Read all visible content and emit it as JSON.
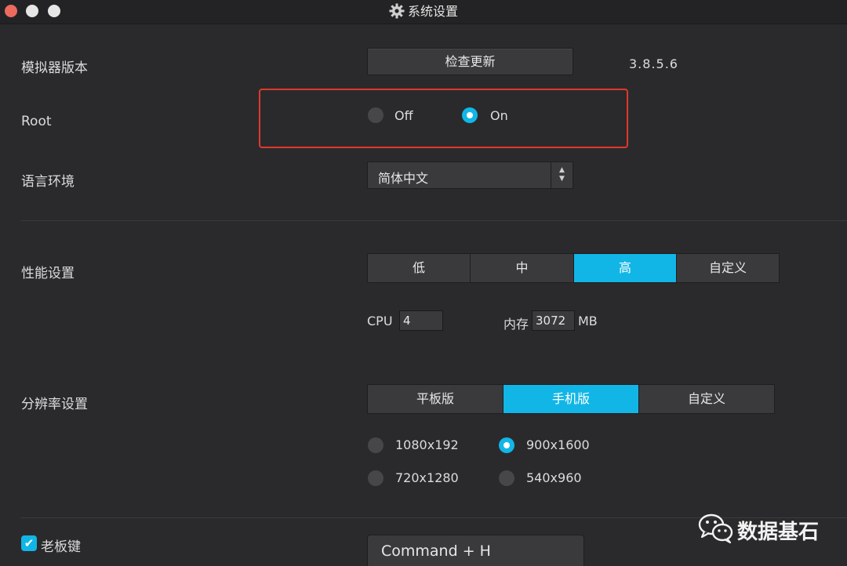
{
  "window": {
    "title": "系统设置",
    "title_icon": "gear-icon"
  },
  "emulator_version": {
    "label": "模拟器版本",
    "check_update_label": "检查更新",
    "version": "3.8.5.6"
  },
  "root": {
    "label": "Root",
    "options": [
      {
        "label": "Off",
        "selected": false
      },
      {
        "label": "On",
        "selected": true
      }
    ]
  },
  "language": {
    "label": "语言环境",
    "selected": "简体中文"
  },
  "performance": {
    "label": "性能设置",
    "options": [
      "低",
      "中",
      "高",
      "自定义"
    ],
    "selected": "高",
    "cpu_label": "CPU",
    "cpu_value": "4",
    "memory_label": "内存",
    "memory_value": "3072",
    "memory_unit": "MB"
  },
  "resolution": {
    "label": "分辨率设置",
    "options": [
      "平板版",
      "手机版",
      "自定义"
    ],
    "selected": "手机版",
    "radios": [
      {
        "label": "1080x192",
        "selected": false
      },
      {
        "label": "900x1600",
        "selected": true
      },
      {
        "label": "720x1280",
        "selected": false
      },
      {
        "label": "540x960",
        "selected": false
      }
    ]
  },
  "boss_key": {
    "label": "老板键",
    "checked": true,
    "shortcut": "Command + H"
  },
  "watermark": {
    "icon": "wechat-icon",
    "text": "数据基石"
  },
  "colors": {
    "accent": "#11b6e6",
    "background": "#2a2a2d",
    "highlight_border": "#e0392b"
  }
}
